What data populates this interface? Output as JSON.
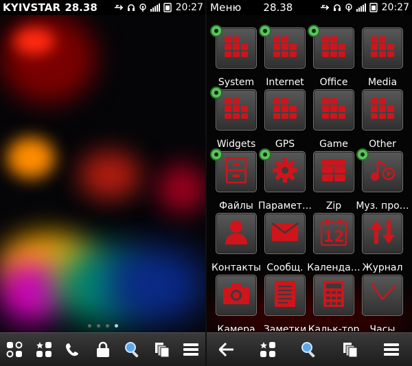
{
  "left": {
    "status": {
      "carrier": "KYIVSTAR",
      "signal": "28.38",
      "time": "20:27"
    },
    "page_dots": {
      "count": 4,
      "active": 3
    },
    "bottom_bar": [
      {
        "name": "apps-grid-icon"
      },
      {
        "name": "favorites-icon"
      },
      {
        "name": "phone-icon"
      },
      {
        "name": "lock-icon"
      },
      {
        "name": "search-icon"
      },
      {
        "name": "tasks-icon"
      },
      {
        "name": "menu-icon"
      }
    ]
  },
  "right": {
    "status": {
      "title": "Меню",
      "signal": "28.38",
      "time": "20:27"
    },
    "items": [
      {
        "label": "System",
        "icon": "folder-grid",
        "badge": true
      },
      {
        "label": "Internet",
        "icon": "folder-grid",
        "badge": true
      },
      {
        "label": "Office",
        "icon": "folder-grid",
        "badge": true
      },
      {
        "label": "Media",
        "icon": "folder-grid",
        "badge": false
      },
      {
        "label": "Widgets",
        "icon": "folder-grid",
        "badge": true
      },
      {
        "label": "GPS",
        "icon": "folder-grid",
        "badge": false
      },
      {
        "label": "Game",
        "icon": "folder-grid",
        "badge": false
      },
      {
        "label": "Other",
        "icon": "folder-grid",
        "badge": false
      },
      {
        "label": "Файлы",
        "icon": "cabinet",
        "badge": true
      },
      {
        "label": "Парамет…",
        "icon": "gear",
        "badge": true
      },
      {
        "label": "Zip",
        "icon": "zip",
        "badge": false
      },
      {
        "label": "Муз. про…",
        "icon": "music",
        "badge": true
      },
      {
        "label": "Контакты",
        "icon": "contact",
        "badge": false
      },
      {
        "label": "Сообщ.",
        "icon": "envelope",
        "badge": false
      },
      {
        "label": "Календа…",
        "icon": "calendar",
        "badge": false
      },
      {
        "label": "Журнал",
        "icon": "log",
        "badge": false
      },
      {
        "label": "Камера",
        "icon": "camera",
        "badge": false
      },
      {
        "label": "Заметки",
        "icon": "notes",
        "badge": false
      },
      {
        "label": "Кальк-тор",
        "icon": "calculator",
        "badge": false
      },
      {
        "label": "Часы",
        "icon": "clock",
        "badge": false
      }
    ],
    "bottom_bar": [
      {
        "name": "back-arrow-icon"
      },
      {
        "name": "favorites-icon"
      },
      {
        "name": "search-icon"
      },
      {
        "name": "tasks-icon"
      },
      {
        "name": "menu-icon"
      }
    ]
  },
  "calendar_number": "12",
  "colors": {
    "accent_red": "#d0141b",
    "badge_green": "#5cc35c"
  }
}
